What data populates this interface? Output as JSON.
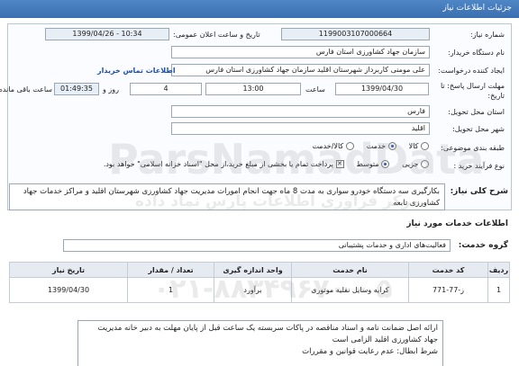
{
  "header": {
    "title": "جزئیات اطلاعات نیاز"
  },
  "form": {
    "need_number_label": "شماره نیاز:",
    "need_number": "1199003107000664",
    "announce_label": "تاریخ و ساعت اعلان عمومی:",
    "announce_value": "1399/04/26 - 10:34",
    "buyer_label": "نام دستگاه خریدار:",
    "buyer_value": "سازمان جهاد کشاورزی استان فارس",
    "creator_label": "ایجاد کننده درخواست:",
    "creator_value": "علی  مومنی  کاربرداز شهرستان اقلید  سازمان جهاد کشاورزی استان فارس",
    "contact_link": "اطلاعات تماس خریدار",
    "deadline_label": "مهلت ارسال پاسخ: تا تاریخ:",
    "deadline_date": "1399/04/30",
    "time_label": "ساعت",
    "deadline_time": "13:00",
    "days_value": "4",
    "days_label": "روز و",
    "remaining_time": "01:49:35",
    "remaining_label": "ساعت باقی مانده",
    "province_label": "استان محل تحویل:",
    "province_value": "فارس",
    "city_label": "شهر محل تحویل:",
    "city_value": "اقلید",
    "category_label": "طبقه بندی موضوعی:",
    "category_options": [
      "کالا",
      "خدمت",
      "کالا/خدمت"
    ],
    "category_selected": "خدمت",
    "process_label": "نوع فرآیند خرید :",
    "process_options": [
      "جزیی",
      "متوسط"
    ],
    "process_selected": "متوسط",
    "payment_note": "پرداخت تمام یا بخشی از مبلغ خرید،از محل \"اسناد خزانه اسلامی\" خواهد بود."
  },
  "summary": {
    "label": "شرح کلی نیاز:",
    "text": "بکارگیری سه دستگاه خودرو سواری به مدت 8 ماه جهت انجام امورات مدیریت جهاد کشاورزی شهرستان اقلید و مراکز خدمات جهاد کشاورزی تابعه"
  },
  "services": {
    "section_title": "اطلاعات خدمات مورد نیاز",
    "group_label": "گروه خدمت:",
    "group_value": "فعالیت‌های اداری و خدمات پشتیبانی",
    "columns": [
      "ردیف",
      "کد خدمت",
      "نام خدمت",
      "واحد اندازه گیری",
      "تعداد / مقدار",
      "تاریخ نیاز"
    ],
    "rows": [
      {
        "index": "1",
        "code": "ز-77-771",
        "name": "کرایه وسایل نقلیه موتوری",
        "unit": "برآورد",
        "qty": "1",
        "date": "1399/04/30"
      }
    ]
  },
  "notes": {
    "text": "ارائه اصل ضمانت نامه و اسناد مناقصه  در پاکات سربسته یک ساعت قبل از پایان مهلت به دبیر خانه مدیریت جهاد کشاورزی اقلید الزامی است\nشرط ابطال: عدم رعایت قوانین و مقررات"
  },
  "watermark": {
    "line1": "ParsNamadData",
    "line2": "مرکز فراوری اطلاعات پارس نماد داده",
    "phone": "۰۲۱-۸۸۳۴۹۶۷۰ - ۵"
  },
  "colors": {
    "header_bg": "#3a6fb0",
    "link": "#1a4fb3",
    "panel_border": "#b9c6d6"
  }
}
